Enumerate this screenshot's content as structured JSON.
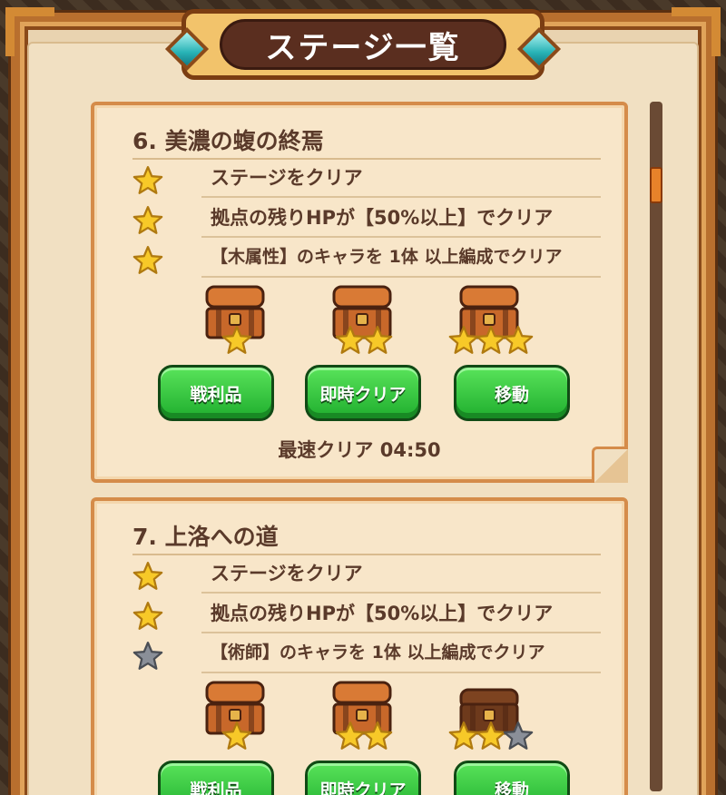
{
  "header": {
    "title": "ステージ一覧"
  },
  "stages": [
    {
      "name": "6. 美濃の蝮の終焉",
      "missions": [
        {
          "text": "ステージをクリア",
          "achieved": true
        },
        {
          "text": "拠点の残りHPが【50%以上】でクリア",
          "achieved": true
        },
        {
          "text": "【木属性】のキャラを 1体 以上編成でクリア",
          "achieved": true
        }
      ],
      "rewards": [
        {
          "stars_total": 1,
          "stars_filled": 1,
          "chest": "open"
        },
        {
          "stars_total": 2,
          "stars_filled": 2,
          "chest": "open"
        },
        {
          "stars_total": 3,
          "stars_filled": 3,
          "chest": "open"
        }
      ],
      "buttons": {
        "loot": "戦利品",
        "instant_clear": "即時クリア",
        "move": "移動"
      },
      "best_time": "最速クリア 04:50"
    },
    {
      "name": "7. 上洛への道",
      "missions": [
        {
          "text": "ステージをクリア",
          "achieved": true
        },
        {
          "text": "拠点の残りHPが【50%以上】でクリア",
          "achieved": true
        },
        {
          "text": "【術師】のキャラを 1体 以上編成でクリア",
          "achieved": false
        }
      ],
      "rewards": [
        {
          "stars_total": 1,
          "stars_filled": 1,
          "chest": "open"
        },
        {
          "stars_total": 2,
          "stars_filled": 2,
          "chest": "open"
        },
        {
          "stars_total": 3,
          "stars_filled": 2,
          "chest": "closed"
        }
      ],
      "buttons": {
        "loot": "戦利品",
        "instant_clear": "即時クリア",
        "move": "移動"
      }
    }
  ],
  "colors": {
    "star_gold": "#f7c928",
    "star_gray": "#8a8f98",
    "button_green": "#2fc23c",
    "accent_orange": "#e8822a"
  }
}
